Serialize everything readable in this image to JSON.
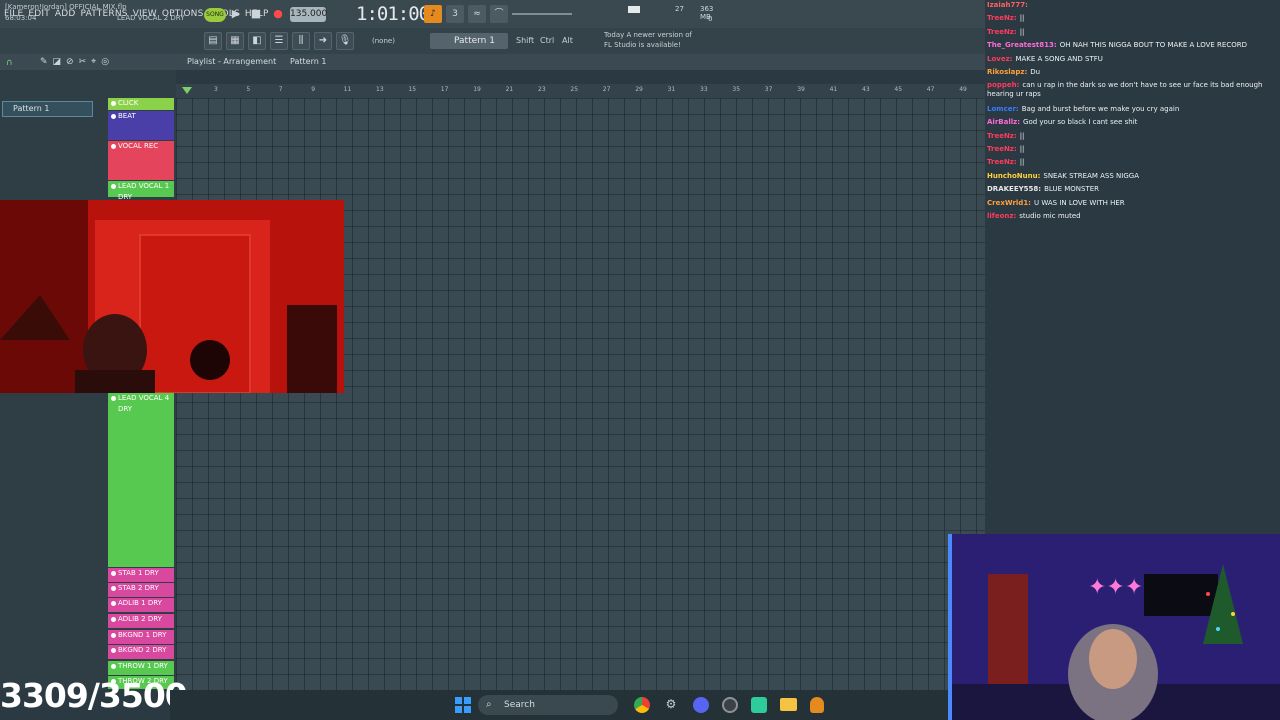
{
  "menu": [
    "FILE",
    "EDIT",
    "ADD",
    "PATTERNS",
    "VIEW",
    "OPTIONS",
    "TOOLS",
    "HELP"
  ],
  "transport": {
    "mode": "SONG",
    "tempo": "135.000",
    "time": "1:01:00"
  },
  "status": {
    "cpu_left": "27",
    "memory": "363 MB",
    "poly": "0"
  },
  "project": {
    "name": "[Kameron!Jordan] OFFICIAL MIX.flp",
    "time": "68:03:04",
    "channel": "LEAD VOCAL 2 DRY"
  },
  "toolbar": {
    "none_label": "(none)",
    "pattern_label": "Pattern 1",
    "shift": "Shift",
    "ctrl": "Ctrl",
    "alt": "Alt"
  },
  "news": {
    "line1": "Today  A newer version of",
    "line2": "FL Studio is available!"
  },
  "playlist": {
    "title": "Playlist - Arrangement",
    "pattern": "Pattern 1"
  },
  "picker": {
    "items": [
      "Pattern 1"
    ]
  },
  "ruler": [
    "3",
    "5",
    "7",
    "9",
    "11",
    "13",
    "15",
    "17",
    "19",
    "21",
    "23",
    "25",
    "27",
    "29",
    "31",
    "33",
    "35",
    "37",
    "39",
    "41",
    "43",
    "45",
    "47",
    "49"
  ],
  "tracks": [
    {
      "name": "CLICK",
      "color": "#8bd14a"
    },
    {
      "name": "BEAT",
      "color": "#4a3ea8"
    },
    {
      "name": "VOCAL REC",
      "color": "#e4455c"
    },
    {
      "name": "LEAD VOCAL 1 DRY",
      "color": "#58c950"
    },
    {
      "name": "LEAD VOCAL 4 DRY",
      "color": "#58c950"
    },
    {
      "name": "STAB 1 DRY",
      "color": "#d8489e"
    },
    {
      "name": "STAB 2 DRY",
      "color": "#d8489e"
    },
    {
      "name": "ADLIB 1 DRY",
      "color": "#d8489e"
    },
    {
      "name": "ADLIB 2 DRY",
      "color": "#d8489e"
    },
    {
      "name": "BKGND 1 DRY",
      "color": "#d8489e"
    },
    {
      "name": "BKGND 2 DRY",
      "color": "#d8489e"
    },
    {
      "name": "THROW 1 DRY",
      "color": "#58c950"
    },
    {
      "name": "THROW 2 DRY",
      "color": "#58c950"
    }
  ],
  "chat": [
    {
      "user": "Izaiah777:",
      "msg": "",
      "color": "#ff6060"
    },
    {
      "user": "TreeNz:",
      "msg": "||",
      "color": "#ff3b5c"
    },
    {
      "user": "TreeNz:",
      "msg": "||",
      "color": "#ff3b5c"
    },
    {
      "user": "The_Greatest813:",
      "msg": "OH NAH THIS NIGGA BOUT TO MAKE A LOVE RECORD",
      "color": "#ff6ad5"
    },
    {
      "user": "Lovez:",
      "msg": "MAKE A SONG AND STFU",
      "color": "#ff3b5c"
    },
    {
      "user": "Rikoslapz:",
      "msg": "Du",
      "color": "#ff9f3a"
    },
    {
      "user": "poppeh:",
      "msg": "can u rap in the dark so we don't have to see ur face its bad enough hearing ur raps",
      "color": "#ff3b5c"
    },
    {
      "user": "Lomcer:",
      "msg": "Bag and burst before we make you cry again",
      "color": "#3a7bff"
    },
    {
      "user": "AirBallz:",
      "msg": "God your so black I cant see shit",
      "color": "#ff6ad5"
    },
    {
      "user": "TreeNz:",
      "msg": "||",
      "color": "#ff3b5c"
    },
    {
      "user": "TreeNz:",
      "msg": "||",
      "color": "#ff3b5c"
    },
    {
      "user": "TreeNz:",
      "msg": "||",
      "color": "#ff3b5c"
    },
    {
      "user": "HunchoNunu:",
      "msg": "SNEAK STREAM ASS NIGGA",
      "color": "#ffd23a"
    },
    {
      "user": "DRAKEEY558:",
      "msg": "BLUE MONSTER",
      "color": "#e8e8e8"
    },
    {
      "user": "CrexWrld1:",
      "msg": "U WAS IN LOVE WITH HER",
      "color": "#ff9f3a"
    },
    {
      "user": "lifeonz:",
      "msg": "studio mic muted",
      "color": "#ff3b5c"
    }
  ],
  "counter": "3309/3500",
  "taskbar": {
    "search": "Search"
  }
}
